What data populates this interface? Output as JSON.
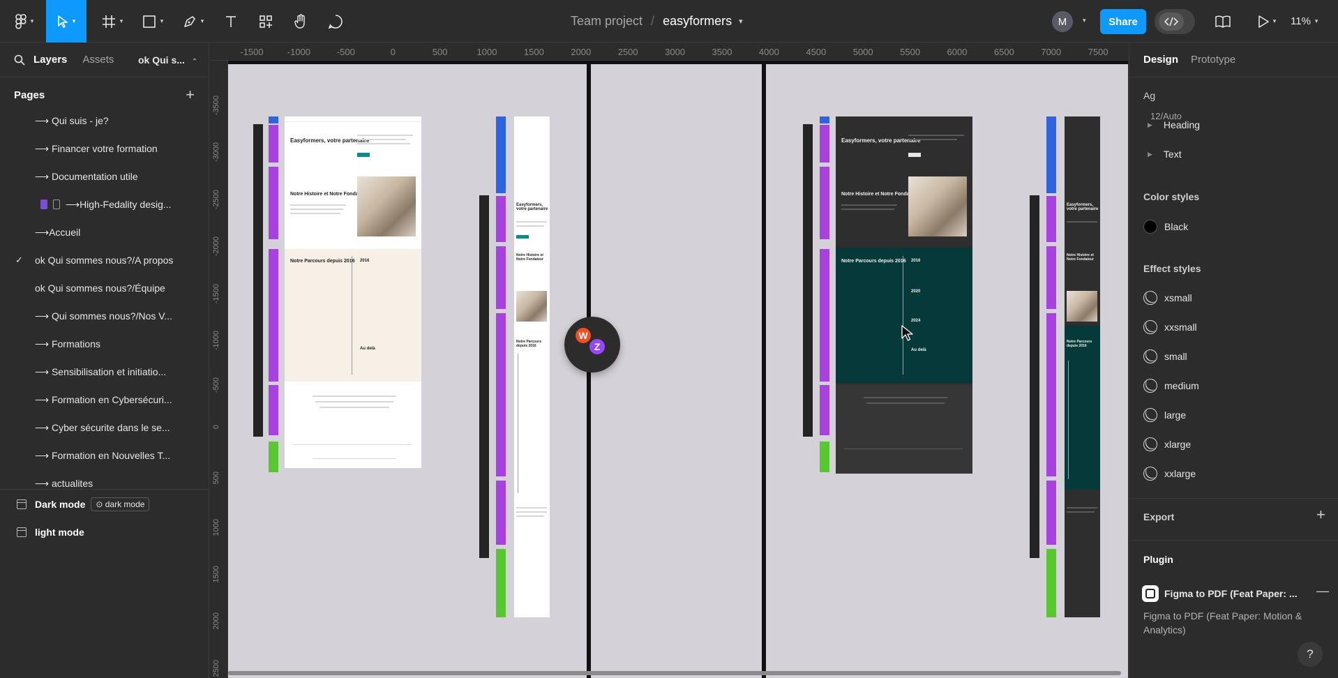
{
  "toolbar": {
    "zoom": "11%",
    "share_label": "Share",
    "user_initial": "M"
  },
  "breadcrumb": {
    "team": "Team project",
    "separator": "/",
    "file": "easyformers"
  },
  "left_panel": {
    "tab_layers": "Layers",
    "tab_assets": "Assets",
    "current_page": "ok Qui s...",
    "pages_label": "Pages",
    "pages": [
      {
        "label": "⟶ Qui suis - je?"
      },
      {
        "label": "⟶ Financer votre formation"
      },
      {
        "label": "⟶ Documentation utile"
      },
      {
        "label": "⟶High-Fedality desig..."
      },
      {
        "label": "⟶Accueil"
      },
      {
        "label": "ok Qui sommes nous?/A propos"
      },
      {
        "label": "ok Qui sommes nous?/Équipe"
      },
      {
        "label": "⟶ Qui sommes nous?/Nos V..."
      },
      {
        "label": "⟶ Formations"
      },
      {
        "label": "⟶ Sensibilisation et initiatio..."
      },
      {
        "label": "⟶ Formation en Cybersécuri..."
      },
      {
        "label": "⟶ Cyber sécurite dans le se..."
      },
      {
        "label": "⟶ Formation en Nouvelles T..."
      },
      {
        "label": "⟶ actualites"
      }
    ],
    "layers": [
      {
        "name": "Dark mode",
        "tag": "dark mode"
      },
      {
        "name": "light mode"
      }
    ]
  },
  "canvas": {
    "ruler_top": [
      "-1500",
      "-1000",
      "-500",
      "0",
      "500",
      "1000",
      "1500",
      "2000",
      "2500",
      "3000",
      "3500",
      "4000",
      "4500",
      "5000",
      "5500",
      "6000",
      "6500",
      "7000",
      "7500"
    ],
    "ruler_left": [
      "-3500",
      "-3000",
      "-2500",
      "-2000",
      "-1500",
      "-1000",
      "-500",
      "0",
      "500",
      "1000",
      "1500",
      "2000",
      "2500"
    ],
    "collaborators": [
      "W",
      "Z"
    ],
    "mock_light": {
      "hero": "Easyformers, votre partenaire",
      "story": "Notre Histoire et Notre Fondateur",
      "parcours": "Notre Parcours depuis 2016",
      "year1": "2016",
      "audela": "Au delà"
    },
    "mock_dark": {
      "hero": "Easyformers, votre partenaire",
      "story": "Notre Histoire et Notre Fondateur",
      "parcours": "Notre Parcours depuis 2016",
      "year1": "2016",
      "year2": "2020",
      "year3": "2024",
      "audela": "Au delà"
    },
    "mock_mobile": {
      "hero": "Easyformers, votre partenaire",
      "story": "Notre Histoire et Notre Fondateur",
      "parcours": "Notre Parcours depuis 2016"
    }
  },
  "right_panel": {
    "tab_design": "Design",
    "tab_prototype": "Prototype",
    "text_styles_label": "Ag",
    "text_styles_sub": "12/Auto",
    "text_styles": [
      "Heading",
      "Text"
    ],
    "color_styles_label": "Color styles",
    "color_styles": [
      {
        "name": "Black",
        "hex": "#000000"
      }
    ],
    "effect_styles_label": "Effect styles",
    "effect_styles": [
      "xsmall",
      "xxsmall",
      "small",
      "medium",
      "large",
      "xlarge",
      "xxlarge"
    ],
    "export_label": "Export",
    "plugin_label": "Plugin",
    "plugin_name": "Figma to PDF (Feat Paper: ...",
    "plugin_desc": "Figma to PDF (Feat Paper: Motion & Analytics)",
    "help": "?"
  },
  "colors": {
    "accent": "#0d99ff",
    "panel": "#2c2c2c",
    "canvas": "#d4d1d8",
    "purple_section": "#a742e0",
    "blue_section": "#2f63e0",
    "green_section": "#58c831",
    "teal_section": "#063a3a"
  }
}
